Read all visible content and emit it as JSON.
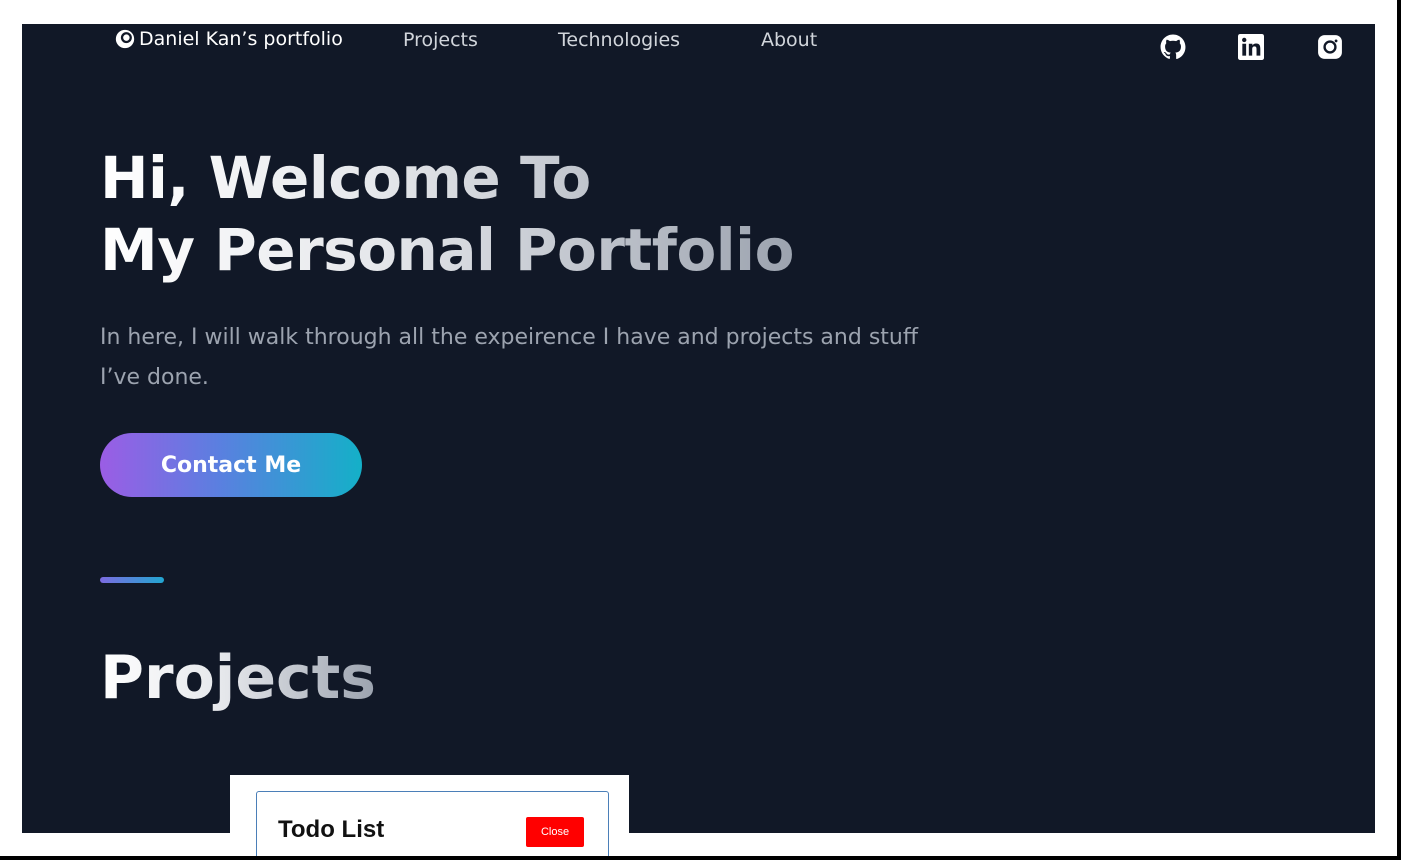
{
  "nav": {
    "logo_text": "Daniel Kan’s portfolio",
    "links": [
      "Projects",
      "Technologies",
      "About"
    ],
    "social": [
      "github-icon",
      "linkedin-icon",
      "instagram-icon"
    ]
  },
  "hero": {
    "title_line1": "Hi, Welcome To",
    "title_line2": "My Personal Portfolio",
    "subtitle": "In here, I will walk through all the expeirence I have and projects and stuff I’ve done.",
    "cta_label": "Contact Me"
  },
  "projects": {
    "heading": "Projects",
    "card": {
      "title": "Todo List",
      "close_label": "Close"
    }
  },
  "colors": {
    "background": "#111827",
    "text_muted": "#9ca3af",
    "accent_start": "#9b5de5",
    "accent_end": "#14b0c8",
    "close_button": "#ff0000"
  }
}
